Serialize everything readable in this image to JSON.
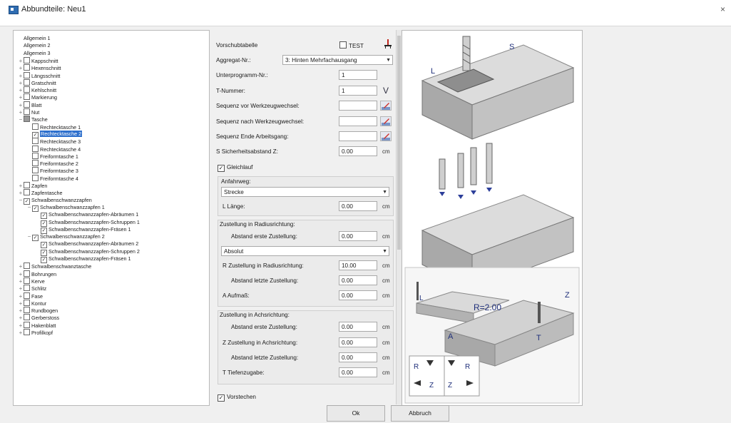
{
  "window": {
    "title": "Abbundteile: Neu1",
    "close": "×"
  },
  "tree": [
    {
      "label": "Allgemein 1",
      "level": 0,
      "exp": "",
      "cb": "none"
    },
    {
      "label": "Allgemein 2",
      "level": 0,
      "exp": "",
      "cb": "none"
    },
    {
      "label": "Allgemein 3",
      "level": 0,
      "exp": "",
      "cb": "none"
    },
    {
      "label": "Kappschnitt",
      "level": 0,
      "exp": "+",
      "cb": "empty"
    },
    {
      "label": "Hexenschnitt",
      "level": 0,
      "exp": "+",
      "cb": "empty"
    },
    {
      "label": "Längsschnitt",
      "level": 0,
      "exp": "+",
      "cb": "empty"
    },
    {
      "label": "Gratschnitt",
      "level": 0,
      "exp": "+",
      "cb": "empty"
    },
    {
      "label": "Kehlschnitt",
      "level": 0,
      "exp": "+",
      "cb": "empty"
    },
    {
      "label": "Markierung",
      "level": 0,
      "exp": "+",
      "cb": "empty"
    },
    {
      "label": "Blatt",
      "level": 0,
      "exp": "+",
      "cb": "empty"
    },
    {
      "label": "Nut",
      "level": 0,
      "exp": "+",
      "cb": "empty"
    },
    {
      "label": "Tasche",
      "level": 0,
      "exp": "−",
      "cb": "partial"
    },
    {
      "label": "Rechtecktasche 1",
      "level": 1,
      "exp": "",
      "cb": "empty"
    },
    {
      "label": "Rechtecktasche 2",
      "level": 1,
      "exp": "",
      "cb": "checked",
      "selected": true
    },
    {
      "label": "Rechtecktasche 3",
      "level": 1,
      "exp": "",
      "cb": "empty"
    },
    {
      "label": "Rechtecktasche 4",
      "level": 1,
      "exp": "",
      "cb": "empty"
    },
    {
      "label": "Freiformtasche 1",
      "level": 1,
      "exp": "",
      "cb": "empty"
    },
    {
      "label": "Freiformtasche 2",
      "level": 1,
      "exp": "",
      "cb": "empty"
    },
    {
      "label": "Freiformtasche 3",
      "level": 1,
      "exp": "",
      "cb": "empty"
    },
    {
      "label": "Freiformtasche 4",
      "level": 1,
      "exp": "",
      "cb": "empty"
    },
    {
      "label": "Zapfen",
      "level": 0,
      "exp": "+",
      "cb": "empty"
    },
    {
      "label": "Zapfentasche",
      "level": 0,
      "exp": "+",
      "cb": "empty"
    },
    {
      "label": "Schwalbenschwanzzapfen",
      "level": 0,
      "exp": "−",
      "cb": "checked"
    },
    {
      "label": "Schwalbenschwanzzapfen 1",
      "level": 1,
      "exp": "−",
      "cb": "checked"
    },
    {
      "label": "Schwalbenschwanzzapfen-Abräumen 1",
      "level": 2,
      "exp": "",
      "cb": "checked"
    },
    {
      "label": "Schwalbenschwanzzapfen-Schruppen 1",
      "level": 2,
      "exp": "",
      "cb": "checked"
    },
    {
      "label": "Schwalbenschwanzzapfen-Fräsen 1",
      "level": 2,
      "exp": "",
      "cb": "checked"
    },
    {
      "label": "Schwalbenschwanzzapfen 2",
      "level": 1,
      "exp": "−",
      "cb": "checked"
    },
    {
      "label": "Schwalbenschwanzzapfen-Abräumen 2",
      "level": 2,
      "exp": "",
      "cb": "checked"
    },
    {
      "label": "Schwalbenschwanzzapfen-Schruppen 2",
      "level": 2,
      "exp": "",
      "cb": "checked"
    },
    {
      "label": "Schwalbenschwanzzapfen-Fräsen 1",
      "level": 2,
      "exp": "",
      "cb": "checked"
    },
    {
      "label": "Schwalbenschwanztasche",
      "level": 0,
      "exp": "+",
      "cb": "empty"
    },
    {
      "label": "Bohrungen",
      "level": 0,
      "exp": "+",
      "cb": "empty"
    },
    {
      "label": "Kerve",
      "level": 0,
      "exp": "+",
      "cb": "empty"
    },
    {
      "label": "Schlitz",
      "level": 0,
      "exp": "+",
      "cb": "empty"
    },
    {
      "label": "Fase",
      "level": 0,
      "exp": "+",
      "cb": "empty"
    },
    {
      "label": "Kontur",
      "level": 0,
      "exp": "+",
      "cb": "empty"
    },
    {
      "label": "Rundbogen",
      "level": 0,
      "exp": "+",
      "cb": "empty"
    },
    {
      "label": "Gerberstoss",
      "level": 0,
      "exp": "+",
      "cb": "empty"
    },
    {
      "label": "Hakenblatt",
      "level": 0,
      "exp": "+",
      "cb": "empty"
    },
    {
      "label": "Profilkopf",
      "level": 0,
      "exp": "+",
      "cb": "empty"
    }
  ],
  "form": {
    "vorschub_label": "Vorschubtabelle",
    "test_label": "TEST",
    "aggregat_label": "Aggregat-Nr.:",
    "aggregat_value": "3: Hinten Mehrfachausgang",
    "unterprogramm_label": "Unterprogramm-Nr.:",
    "unterprogramm_value": "1",
    "tnummer_label": "T-Nummer:",
    "tnummer_value": "1",
    "tnummer_btn": "V",
    "seq_vor_label": "Sequenz vor Werkzeugwechsel:",
    "seq_nach_label": "Sequenz nach Werkzeugwechsel:",
    "seq_ende_label": "Sequenz Ende Arbeitsgang:",
    "sicherheit_label": "S Sicherheitsabstand Z:",
    "sicherheit_value": "0.00",
    "gleichlauf_label": "Gleichlauf",
    "anfahrweg_title": "Anfahrweg:",
    "anfahrweg_value": "Strecke",
    "laenge_label": "L Länge:",
    "laenge_value": "0.00",
    "radius_title": "Zustellung in Radiusrichtung:",
    "abstand_erste_r_label": "Abstand erste Zustellung:",
    "abstand_erste_r_value": "0.00",
    "absolut_value": "Absolut",
    "r_zustellung_label": "R Zustellung in Radiusrichtung:",
    "r_zustellung_value": "10.00",
    "abstand_letzte_r_label": "Abstand letzte Zustellung:",
    "abstand_letzte_r_value": "0.00",
    "aufmass_label": "A Aufmaß:",
    "aufmass_value": "0.00",
    "achs_title": "Zustellung in Achsrichtung:",
    "abstand_erste_a_label": "Abstand erste Zustellung:",
    "abstand_erste_a_value": "0.00",
    "z_zustellung_label": "Z Zustellung in Achsrichtung:",
    "z_zustellung_value": "0.00",
    "abstand_letzte_a_label": "Abstand letzte Zustellung:",
    "abstand_letzte_a_value": "0.00",
    "tiefenzugabe_label": "T Tiefenzugabe:",
    "tiefenzugabe_value": "0.00",
    "vorstechen_label": "Vorstechen",
    "unit": "cm"
  },
  "diagram": {
    "S": "S",
    "L": "L",
    "R_value": "R=2.00",
    "Z": "Z",
    "T": "T",
    "A": "A",
    "R": "R"
  },
  "buttons": {
    "ok": "Ok",
    "cancel": "Abbruch"
  }
}
